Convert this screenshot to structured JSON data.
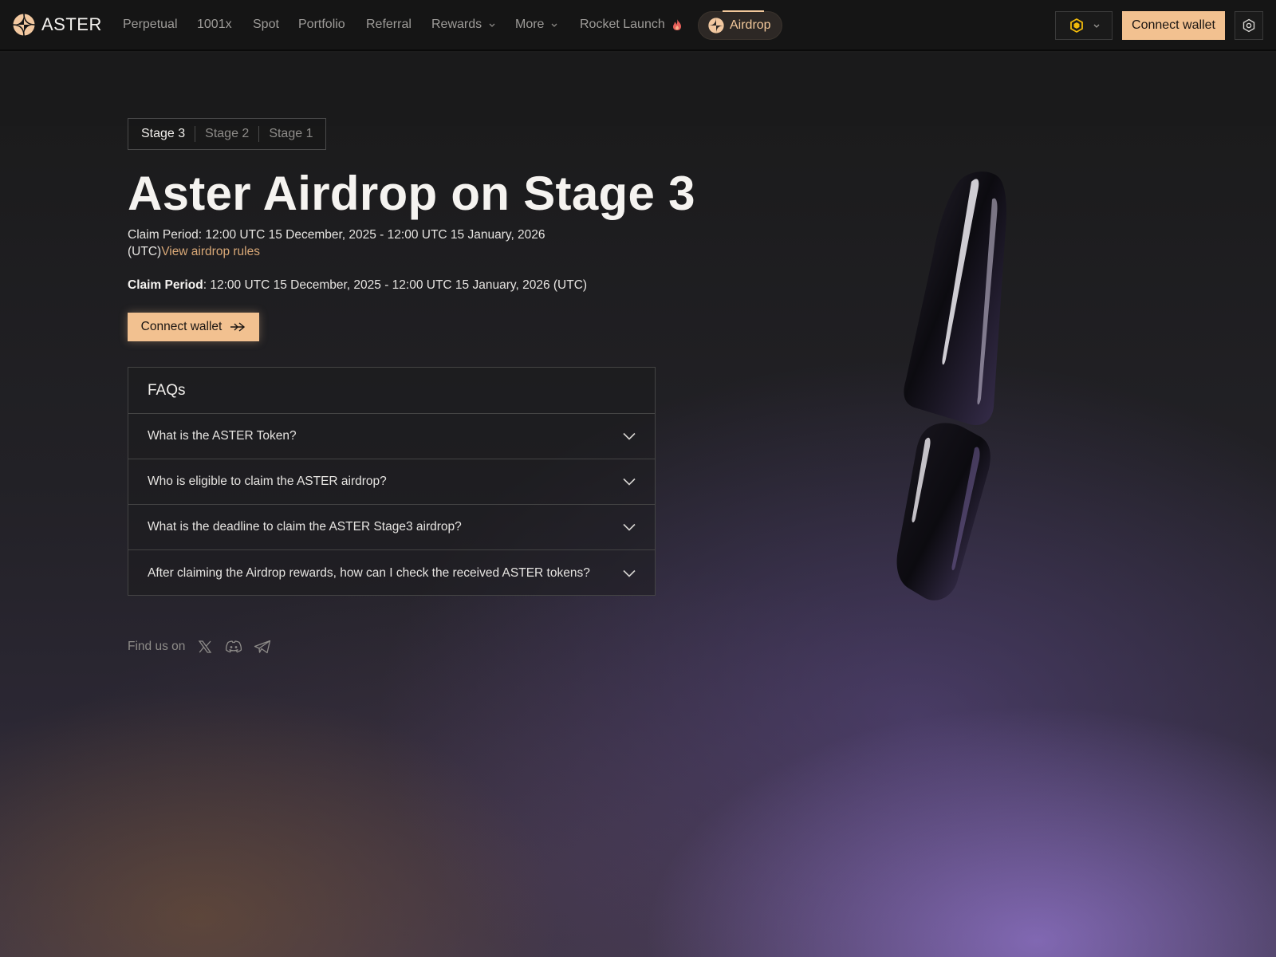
{
  "nav": {
    "brand": "ASTER",
    "items": [
      {
        "label": "Perpetual"
      },
      {
        "label": "1001x"
      },
      {
        "label": "Spot"
      },
      {
        "label": "Portfolio"
      },
      {
        "label": "Referral"
      },
      {
        "label": "Rewards"
      },
      {
        "label": "More"
      },
      {
        "label": "Rocket Launch"
      }
    ],
    "airdrop_label": "Airdrop",
    "connect_label": "Connect wallet",
    "chain_icon": "bnb-chain-icon",
    "settings_icon": "settings-icon"
  },
  "stages": [
    {
      "label": "Stage 3",
      "active": true
    },
    {
      "label": "Stage 2",
      "active": false
    },
    {
      "label": "Stage 1",
      "active": false
    }
  ],
  "hero": {
    "title": "Aster Airdrop on Stage 3",
    "claim_text": "Claim Period: 12:00 UTC 15 December, 2025 - 12:00 UTC 15 January, 2026 (UTC)",
    "rules_link": "View airdrop rules",
    "claim_label": "Claim Period",
    "claim_value": ": 12:00 UTC 15 December, 2025 - 12:00 UTC 15 January, 2026 (UTC)",
    "cta_label": "Connect wallet"
  },
  "faq": {
    "title": "FAQs",
    "items": [
      {
        "question": "What is the ASTER Token?"
      },
      {
        "question": "Who is eligible to claim the ASTER airdrop?"
      },
      {
        "question": "What is the deadline to claim the ASTER Stage3 airdrop?"
      },
      {
        "question": "After claiming the Airdrop rewards, how can I check the received ASTER tokens?"
      }
    ]
  },
  "footer": {
    "find_us": "Find us on",
    "socials": [
      "x-icon",
      "discord-icon",
      "telegram-icon"
    ]
  },
  "colors": {
    "accent": "#f2c190",
    "link": "#d9a877",
    "nav_bg": "#151515"
  }
}
